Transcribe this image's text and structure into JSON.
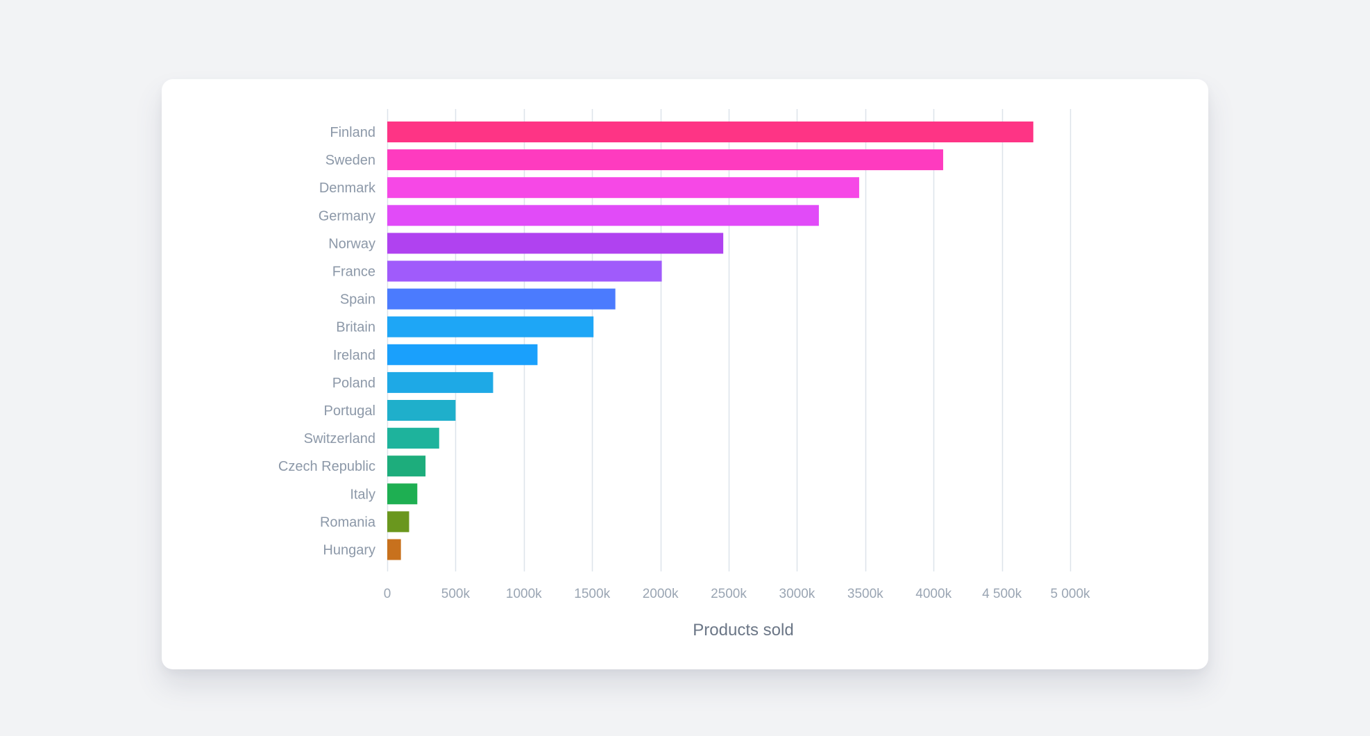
{
  "chart_data": {
    "type": "bar",
    "orientation": "horizontal",
    "title": "",
    "xlabel": "Products sold",
    "ylabel": "",
    "xlim": [
      0,
      5000000
    ],
    "grid": true,
    "legend": "none",
    "x_ticks": [
      0,
      500000,
      1000000,
      1500000,
      2000000,
      2500000,
      3000000,
      3500000,
      4000000,
      4500000,
      5000000
    ],
    "x_tick_labels": [
      "0",
      "500k",
      "1000k",
      "1500k",
      "2000k",
      "2500k",
      "3000k",
      "3500k",
      "4000k",
      "4 500k",
      "5 000k"
    ],
    "categories": [
      "Finland",
      "Sweden",
      "Denmark",
      "Germany",
      "Norway",
      "France",
      "Spain",
      "Britain",
      "Ireland",
      "Poland",
      "Portugal",
      "Switzerland",
      "Czech Republic",
      "Italy",
      "Romania",
      "Hungary"
    ],
    "values": [
      4730000,
      4070000,
      3455000,
      3160000,
      2460000,
      2010000,
      1670000,
      1510000,
      1100000,
      775000,
      500000,
      380000,
      280000,
      220000,
      160000,
      100000
    ],
    "colors": [
      "#fe3485",
      "#fe3bbf",
      "#f648e6",
      "#e14bf8",
      "#b042f0",
      "#a05bfb",
      "#4b7bfe",
      "#1ea6f6",
      "#1aa0fc",
      "#1ea9e6",
      "#1fafcb",
      "#1eb39c",
      "#1dad7c",
      "#1eaf52",
      "#6a971e",
      "#c8711d"
    ]
  }
}
